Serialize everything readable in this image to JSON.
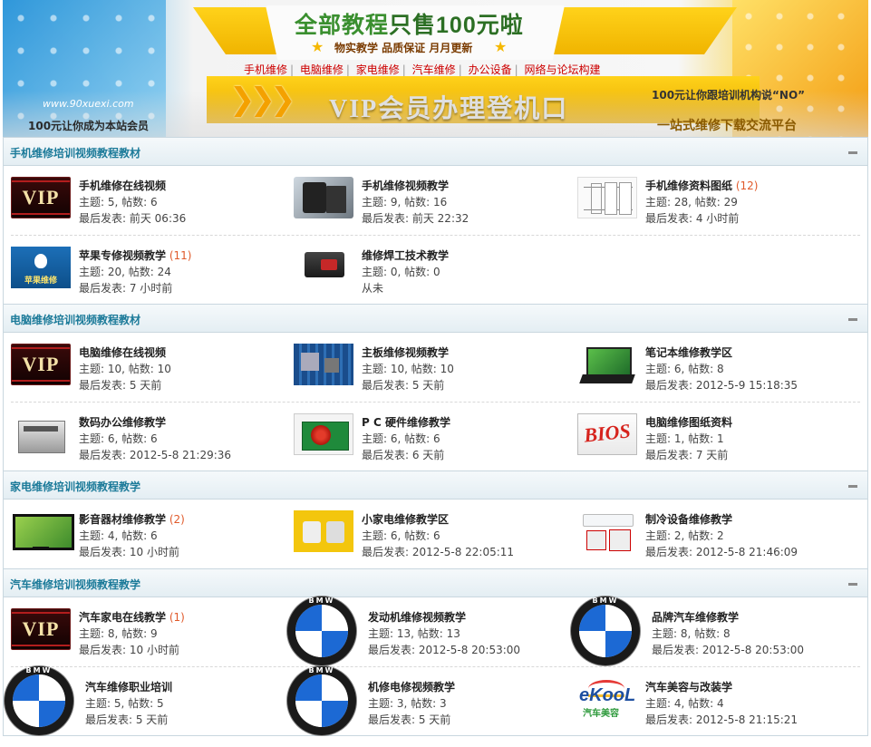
{
  "banner": {
    "headline_a": "全部教程",
    "headline_b": "只售100元啦",
    "subline": "物实教学 品质保证 月月更新",
    "nav": [
      "手机维修",
      "电脑维修",
      "家电维修",
      "汽车维修",
      "办公设备",
      "网络与论坛构建"
    ],
    "vip_title": "VIP会员办理登机口",
    "site_url": "www.90xuexi.com",
    "member_left": "100元让你成为本站会员",
    "slogan_right": "100元让你跟培训机构说“NO”",
    "platform": "一站式维修下载交流平台"
  },
  "sections": [
    {
      "title": "手机维修培训视频教程教材",
      "forums": [
        {
          "name": "手机维修在线视频",
          "new": "",
          "stat": "主题: 5, 帖数: 6",
          "last": "最后发表: 前天 06:36",
          "icon": "vip-icon"
        },
        {
          "name": "手机维修视频教学",
          "new": "",
          "stat": "主题: 9, 帖数: 16",
          "last": "最后发表: 前天 22:32",
          "icon": "phone-icon"
        },
        {
          "name": "手机维修资料图纸",
          "new": "(12)",
          "stat": "主题: 28, 帖数: 29",
          "last": "最后发表: 4 小时前",
          "icon": "schematic-icon"
        },
        {
          "name": "苹果专修视频教学",
          "new": "(11)",
          "stat": "主题: 20, 帖数: 24",
          "last": "最后发表: 7 小时前",
          "icon": "apple-icon",
          "label": "苹果维修"
        },
        {
          "name": "维修焊工技术教学",
          "new": "",
          "stat": "主题: 0, 帖数: 0",
          "last": "从未",
          "icon": "solder-station-icon"
        }
      ]
    },
    {
      "title": "电脑维修培训视频教程教材",
      "forums": [
        {
          "name": "电脑维修在线视频",
          "new": "",
          "stat": "主题: 10, 帖数: 10",
          "last": "最后发表: 5 天前",
          "icon": "vip-icon"
        },
        {
          "name": "主板维修视频教学",
          "new": "",
          "stat": "主题: 10, 帖数: 10",
          "last": "最后发表: 5 天前",
          "icon": "motherboard-icon"
        },
        {
          "name": "笔记本维修教学区",
          "new": "",
          "stat": "主题: 6, 帖数: 8",
          "last": "最后发表: 2012-5-9 15:18:35",
          "icon": "laptop-icon"
        },
        {
          "name": "数码办公维修教学",
          "new": "",
          "stat": "主题: 6, 帖数: 6",
          "last": "最后发表: 2012-5-8 21:29:36",
          "icon": "copier-icon"
        },
        {
          "name": "P C 硬件维修教学",
          "new": "",
          "stat": "主题: 6, 帖数: 6",
          "last": "最后发表: 6 天前",
          "icon": "graphics-card-icon"
        },
        {
          "name": "电脑维修图纸资料",
          "new": "",
          "stat": "主题: 1, 帖数: 1",
          "last": "最后发表: 7 天前",
          "icon": "bios-icon",
          "label": "BIOS"
        }
      ]
    },
    {
      "title": "家电维修培训视频教程教学",
      "forums": [
        {
          "name": "影音器材维修教学",
          "new": "(2)",
          "stat": "主题: 4, 帖数: 6",
          "last": "最后发表: 10 小时前",
          "icon": "tv-icon"
        },
        {
          "name": "小家电维修教学区",
          "new": "",
          "stat": "主题: 6, 帖数: 6",
          "last": "最后发表: 2012-5-8 22:05:11",
          "icon": "small-appliance-icon"
        },
        {
          "name": "制冷设备维修教学",
          "new": "",
          "stat": "主题: 2, 帖数: 2",
          "last": "最后发表: 2012-5-8 21:46:09",
          "icon": "air-conditioner-icon"
        }
      ]
    },
    {
      "title": "汽车维修培训视频教程教学",
      "forums": [
        {
          "name": "汽车家电在线教学",
          "new": "(1)",
          "stat": "主题: 8, 帖数: 9",
          "last": "最后发表: 10 小时前",
          "icon": "vip-icon"
        },
        {
          "name": "发动机维修视频教学",
          "new": "",
          "stat": "主题: 13, 帖数: 13",
          "last": "最后发表: 2012-5-8 20:53:00",
          "icon": "bmw-logo-icon"
        },
        {
          "name": "品牌汽车维修教学",
          "new": "",
          "stat": "主题: 8, 帖数: 8",
          "last": "最后发表: 2012-5-8 20:53:00",
          "icon": "bmw-logo-icon"
        },
        {
          "name": "汽车维修职业培训",
          "new": "",
          "stat": "主题: 5, 帖数: 5",
          "last": "最后发表: 5 天前",
          "icon": "bmw-logo-icon"
        },
        {
          "name": "机修电修视频教学",
          "new": "",
          "stat": "主题: 3, 帖数: 3",
          "last": "最后发表: 5 天前",
          "icon": "bmw-logo-icon"
        },
        {
          "name": "汽车美容与改装学",
          "new": "",
          "stat": "主题: 4, 帖数: 4",
          "last": "最后发表: 2012-5-8 21:15:21",
          "icon": "ekool-logo-icon",
          "label": "eKooL",
          "sublabel": "汽车美容"
        }
      ]
    }
  ],
  "vip_text": "VIP",
  "bmw_text": "BMW",
  "colors": {
    "section_title": "#1b7a99",
    "new_count": "#e05a2b",
    "nav_link": "#cc0000"
  }
}
